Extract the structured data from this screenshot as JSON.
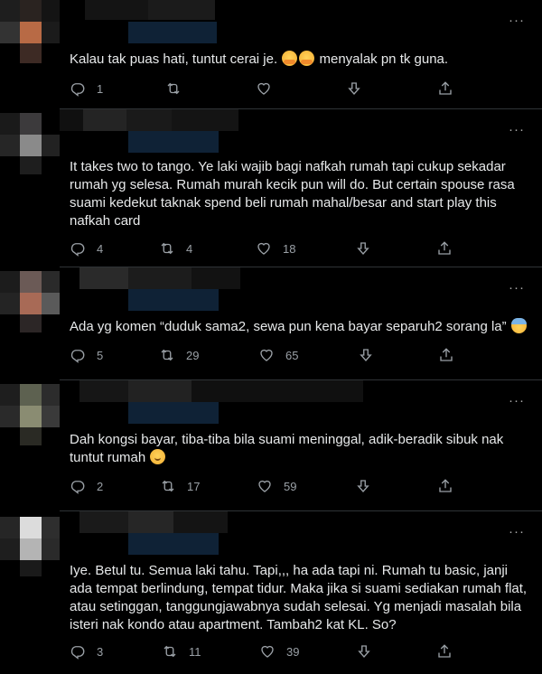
{
  "colors": {
    "background": "#000000",
    "text": "#e7e9ea",
    "icon": "#9aa0a6",
    "divider": "#2f3336"
  },
  "icons": {
    "reply": "reply-icon",
    "retweet": "retweet-icon",
    "like": "like-icon",
    "share_menu": "bookmark-down-icon",
    "share": "share-icon",
    "more": "more-icon"
  },
  "more_label": "···",
  "tweets": [
    {
      "text_before": "Kalau tak puas hati, tuntut cerai je. ",
      "emojis": "🤗🤗",
      "text_after": " menyalak pn tk guna.",
      "reply_count": "1",
      "retweet_count": "",
      "like_count": ""
    },
    {
      "text": "It takes two to tango. Ye laki wajib bagi nafkah rumah tapi cukup sekadar rumah yg selesa. Rumah murah kecik pun will do. But certain spouse rasa suami kedekut taknak spend beli rumah mahal/besar and start play this nafkah card",
      "reply_count": "4",
      "retweet_count": "4",
      "like_count": "18"
    },
    {
      "text_before": "Ada yg komen “duduk sama2, sewa pun kena bayar separuh2 sorang la” ",
      "emojis": "😨",
      "reply_count": "5",
      "retweet_count": "29",
      "like_count": "65"
    },
    {
      "text_before": "Dah kongsi bayar, tiba-tiba bila suami meninggal, adik-beradik sibuk nak tuntut rumah ",
      "emojis": "😌",
      "reply_count": "2",
      "retweet_count": "17",
      "like_count": "59"
    },
    {
      "text": "Iye. Betul tu. Semua laki tahu. Tapi,,, ha ada tapi ni. Rumah tu basic, janji ada tempat berlindung, tempat tidur. Maka jika si suami sediakan rumah flat, atau setinggan, tanggungjawabnya sudah selesai. Yg menjadi masalah bila isteri nak kondo atau apartment. Tambah2 kat KL. So?",
      "reply_count": "3",
      "retweet_count": "11",
      "like_count": "39"
    }
  ]
}
